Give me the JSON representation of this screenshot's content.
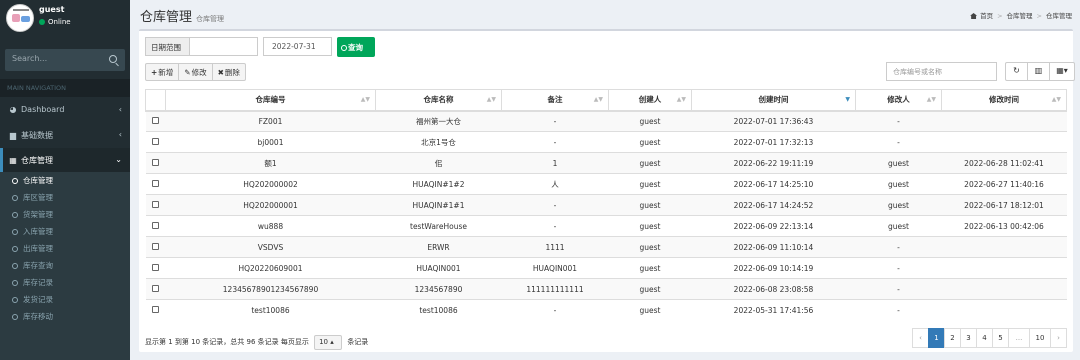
{
  "user": {
    "name": "guest",
    "status": "Online"
  },
  "sidebar": {
    "search_placeholder": "Search...",
    "nav_header": "MAIN NAVIGATION",
    "items": [
      {
        "label": "Dashboard",
        "icon": "dashboard-icon"
      },
      {
        "label": "基础数据",
        "icon": "book-icon"
      },
      {
        "label": "仓库管理",
        "icon": "table-icon"
      }
    ],
    "submenu": [
      "仓库管理",
      "库区管理",
      "货架管理",
      "入库管理",
      "出库管理",
      "库存查询",
      "库存记录",
      "发货记录",
      "库存移动"
    ]
  },
  "header": {
    "title": "仓库管理",
    "subtitle": "仓库管理",
    "breadcrumb": [
      "首页",
      "仓库管理",
      "仓库管理"
    ]
  },
  "filter": {
    "range_label": "日期范围",
    "date_value": "2022-07-31",
    "query_label": "查询"
  },
  "toolbar": {
    "add": "新增",
    "edit": "修改",
    "delete": "删除",
    "search_placeholder": "仓库编号或名称"
  },
  "table": {
    "columns": [
      "仓库编号",
      "仓库名称",
      "备注",
      "创建人",
      "创建时间",
      "修改人",
      "修改时间"
    ],
    "rows": [
      [
        "FZ001",
        "福州第一大仓",
        "-",
        "guest",
        "2022-07-01 17:36:43",
        "-",
        ""
      ],
      [
        "bj0001",
        "北京1号仓",
        "-",
        "guest",
        "2022-07-01 17:32:13",
        "-",
        ""
      ],
      [
        "额1",
        "佀",
        "1",
        "guest",
        "2022-06-22 19:11:19",
        "guest",
        "2022-06-28 11:02:41"
      ],
      [
        "HQ202000002",
        "HUAQIN#1#2",
        "人",
        "guest",
        "2022-06-17 14:25:10",
        "guest",
        "2022-06-27 11:40:16"
      ],
      [
        "HQ202000001",
        "HUAQIN#1#1",
        "-",
        "guest",
        "2022-06-17 14:24:52",
        "guest",
        "2022-06-17 18:12:01"
      ],
      [
        "wu888",
        "testWareHouse",
        "-",
        "guest",
        "2022-06-09 22:13:14",
        "guest",
        "2022-06-13 00:42:06"
      ],
      [
        "VSDVS",
        "ERWR",
        "1111",
        "guest",
        "2022-06-09 11:10:14",
        "-",
        ""
      ],
      [
        "HQ20220609001",
        "HUAQIN001",
        "HUAQIN001",
        "guest",
        "2022-06-09 10:14:19",
        "-",
        ""
      ],
      [
        "12345678901234567890",
        "1234567890",
        "111111111111",
        "guest",
        "2022-06-08 23:08:58",
        "-",
        ""
      ],
      [
        "test10086",
        "test10086",
        "-",
        "guest",
        "2022-05-31 17:41:56",
        "-",
        ""
      ]
    ]
  },
  "pager": {
    "info_prefix": "显示第 1 到第 10 条记录，总共 96 条记录 每页显示",
    "page_size": "10",
    "info_suffix": "条记录",
    "pages": [
      "‹",
      "1",
      "2",
      "3",
      "4",
      "5",
      "...",
      "10",
      "›"
    ]
  },
  "colors": {
    "sidebar": "#222d32",
    "accent": "#3c8dbc",
    "green": "#00a65a"
  }
}
